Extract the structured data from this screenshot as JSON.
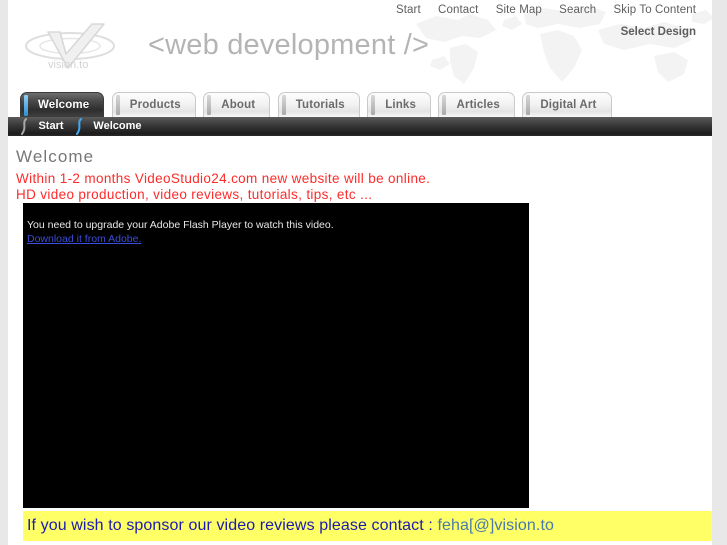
{
  "header": {
    "brand_title": "<web development />",
    "logo_text": "vision.to",
    "select_design": "Select Design",
    "topnav": [
      {
        "label": "Start"
      },
      {
        "label": "Contact"
      },
      {
        "label": "Site Map"
      },
      {
        "label": "Search"
      },
      {
        "label": "Skip To Content"
      }
    ]
  },
  "tabs": [
    {
      "label": "Welcome",
      "active": true
    },
    {
      "label": "Products",
      "active": false
    },
    {
      "label": "About",
      "active": false
    },
    {
      "label": "Tutorials",
      "active": false
    },
    {
      "label": "Links",
      "active": false
    },
    {
      "label": "Articles",
      "active": false
    },
    {
      "label": "Digital Art",
      "active": false
    }
  ],
  "breadcrumb": [
    {
      "label": "Start"
    },
    {
      "label": "Welcome"
    }
  ],
  "main": {
    "page_title": "Welcome",
    "notice_line_1": "Within 1-2 months VideoStudio24.com new website will be online.",
    "notice_line_2": "HD video production, video reviews, tutorials, tips, etc ..."
  },
  "video": {
    "flash_message": "You need to upgrade your Adobe Flash Player to watch this video.",
    "flash_link": "Download it from Adobe."
  },
  "footer": {
    "sponsor_text": "If you wish to sponsor our video reviews please contact : ",
    "sponsor_email": "feha[@]vision.to"
  },
  "colors": {
    "notice_red": "#ff2a2a",
    "banner_yellow": "#ffff66",
    "banner_text_blue": "#1a1ab0",
    "email_blue": "#4a7aa8",
    "tab_active_accent": "#2e8fd0",
    "brand_gray": "#b4b4b4"
  }
}
